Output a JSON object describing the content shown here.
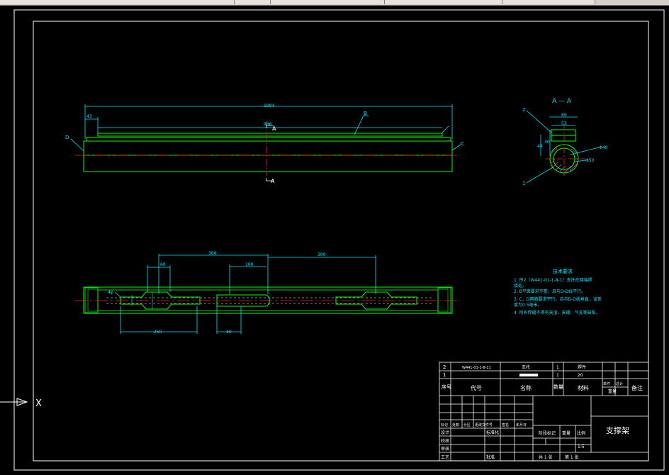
{
  "section_title": "A — A",
  "view_labels": {
    "cut_top": "A",
    "cut_bottom": "A"
  },
  "front_view": {
    "dim_overall": "1004",
    "dim_inner": "986",
    "dim_left": "43",
    "leaders": {
      "b": "B",
      "c": "C",
      "d": "D"
    }
  },
  "section_view": {
    "dim_width": "60",
    "dim_inner": "53",
    "dim_dia": "Φ40",
    "dim_dia2": "Φ50",
    "dim_h": "48",
    "dim_h2": "30",
    "leaders": {
      "part2": "2",
      "part1": "1"
    }
  },
  "plan_view": {
    "dim_top_left": "300",
    "dim_top_right": "300",
    "dim_60": "60",
    "dim_100": "100",
    "dim_250": "250",
    "dim_40": "40",
    "dim_r": "4φ"
  },
  "tech_req": {
    "title": "技术要求",
    "lines": [
      "1. 序2（W441-01-1-8-1）支托在两端焊",
      "   接处。",
      "2. B平面要求平整，且与D-D线平行。",
      "3. C、D两面要求平行，且与D-D线垂直，误差",
      "   度为0.5毫米。",
      "4. 所有焊缝不得有夹渣、夹缝、气孔等缺陷。"
    ]
  },
  "title_block": {
    "rows": [
      {
        "seq": "2",
        "code": "W441-01-1-8-11",
        "name": "支托",
        "qty": "1",
        "material": "焊件"
      },
      {
        "seq": "1",
        "code": "",
        "name": "",
        "qty": "1",
        "material": "20"
      }
    ],
    "header": {
      "seq": "序号",
      "code": "代号",
      "name": "名称",
      "qty": "数量",
      "material": "材料",
      "unit": "单件",
      "total": "总计",
      "weight": "重量",
      "note": "备注"
    },
    "revision_labels": [
      "标记",
      "处数",
      "分区",
      "更改文件号",
      "签名",
      "年月日"
    ],
    "roles": [
      "设计",
      "校核",
      "审核",
      "工艺"
    ],
    "role_tags": [
      "标准化",
      "批准"
    ],
    "stage_labels": [
      "阶段标记",
      "重量",
      "比例"
    ],
    "scale": "1:5",
    "sheets": "共 1 张",
    "sheet_no": "第 1 张",
    "drawing_title": "支撑架"
  },
  "ucs": {
    "x_label": "X"
  }
}
